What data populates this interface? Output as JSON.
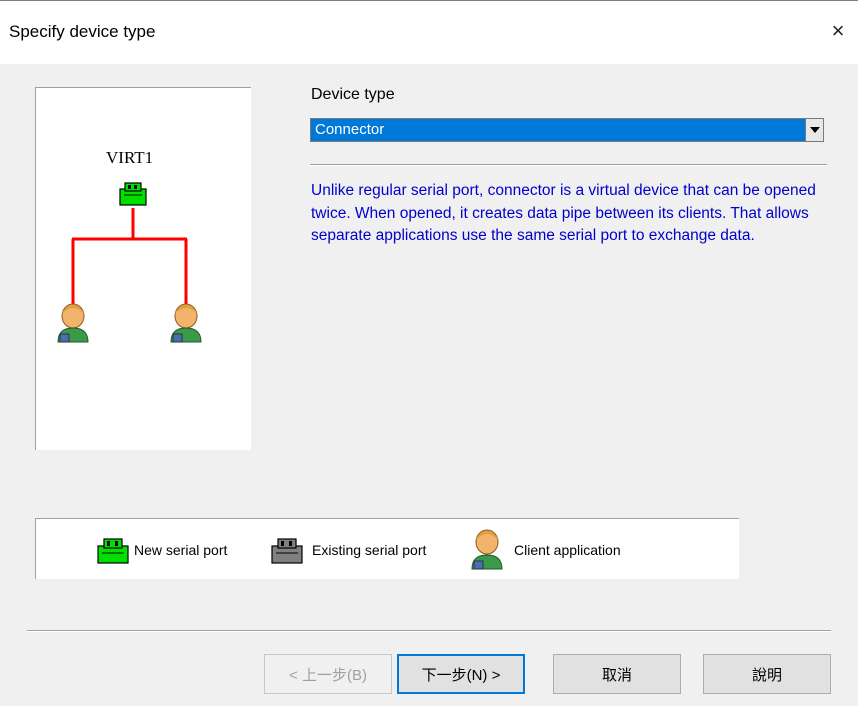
{
  "window": {
    "title": "Specify device type",
    "close_glyph": "×"
  },
  "preview": {
    "device_name": "VIRT1",
    "device_icon": "serial-port-new-icon",
    "line_color": "#ff0000",
    "clients": [
      "client-application-icon",
      "client-application-icon"
    ]
  },
  "device_type": {
    "label": "Device type",
    "selected": "Connector",
    "description": "Unlike regular serial port, connector is a virtual device that can be opened twice. When opened, it creates data pipe between its clients. That allows separate applications use the same serial port to exchange data."
  },
  "legend": {
    "items": [
      {
        "icon": "serial-port-new-icon",
        "label": "New serial port",
        "color": "#00ff00"
      },
      {
        "icon": "serial-port-existing-icon",
        "label": "Existing serial port",
        "color": "#808080"
      },
      {
        "icon": "client-application-icon",
        "label": "Client application"
      }
    ]
  },
  "buttons": {
    "back": "< 上一步(B)",
    "next": "下一步(N) >",
    "cancel": "取消",
    "help": "說明"
  },
  "colors": {
    "selection": "#0078d7",
    "description_text": "#0000cc",
    "new_port": "#00ff00",
    "existing_port": "#808080"
  }
}
